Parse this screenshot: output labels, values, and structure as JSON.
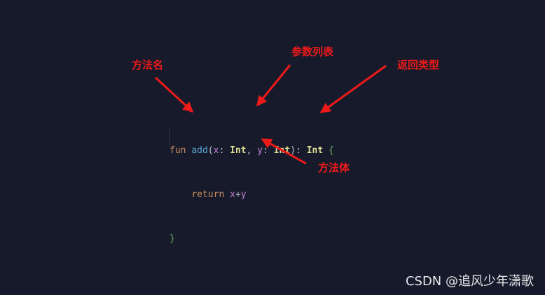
{
  "code": {
    "kw_fun": "fun",
    "fn_name": "add",
    "paren_open": "(",
    "p1": "x",
    "colon1": ": ",
    "t1": "Int",
    "comma": ", ",
    "p2": "y",
    "colon2": ": ",
    "t2": "Int",
    "paren_close": ")",
    "colon3": ": ",
    "ret_type": "Int",
    "brace_open": "{",
    "kw_return": "return",
    "expr_x": "x",
    "expr_plus": "+",
    "expr_y": "y",
    "brace_close": "}"
  },
  "annotations": {
    "method_name": "方法名",
    "param_list": "参数列表",
    "return_type": "返回类型",
    "method_body": "方法体"
  },
  "watermark": "CSDN @追风少年潇歌",
  "colors": {
    "background": "#161a2a",
    "annotation": "#ee1a1a",
    "keyword": "#cc8f62",
    "function": "#5aa6d8",
    "parameter": "#c183d4",
    "type": "#dedc94",
    "brace": "#68a868"
  }
}
